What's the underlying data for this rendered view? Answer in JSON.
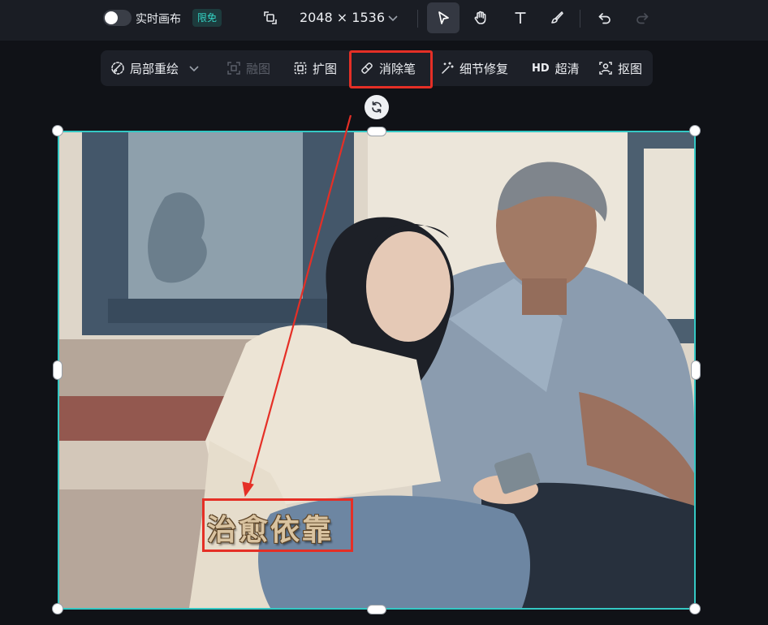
{
  "topbar": {
    "realtime_canvas_label": "实时画布",
    "free_badge": "限免",
    "canvas_size": "2048 × 1536",
    "realtime_toggle_on": false,
    "tools": [
      {
        "name": "select",
        "icon": "pointer-icon",
        "active": true
      },
      {
        "name": "pan",
        "icon": "hand-icon",
        "active": false
      },
      {
        "name": "text",
        "icon": "text-icon",
        "active": false
      },
      {
        "name": "brush",
        "icon": "brush-icon",
        "active": false
      },
      {
        "name": "undo",
        "icon": "undo-icon",
        "active": false
      },
      {
        "name": "redo",
        "icon": "redo-icon",
        "active": false,
        "disabled": true
      }
    ]
  },
  "edit_toolbar": {
    "inpaint": "局部重绘",
    "blend": "融图",
    "expand": "扩图",
    "eraser": "消除笔",
    "detail_fix": "细节修复",
    "hd_badge": "HD",
    "upscale": "超清",
    "cutout": "抠图",
    "highlighted": "eraser"
  },
  "canvas": {
    "watermark_text": "治愈依靠"
  },
  "colors": {
    "selection_border": "#34c8c4",
    "annotation_red": "#e52f26",
    "free_badge_text": "#34d3c4"
  }
}
